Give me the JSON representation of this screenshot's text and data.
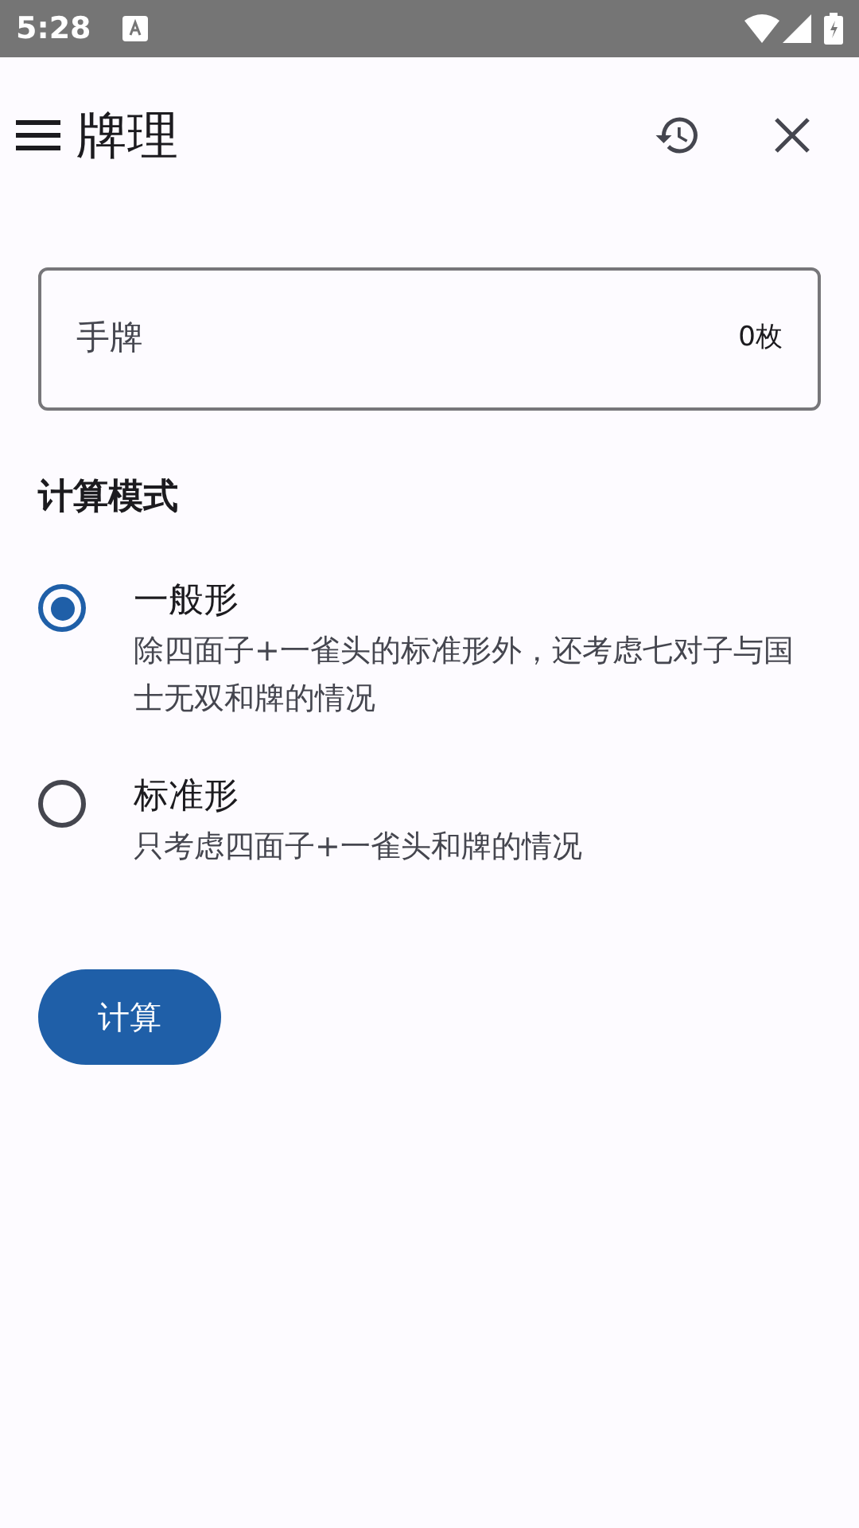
{
  "status_bar": {
    "time": "5:28"
  },
  "app_bar": {
    "title": "牌理"
  },
  "hand_field": {
    "placeholder": "手牌",
    "suffix": "0枚"
  },
  "mode_section": {
    "heading": "计算模式",
    "options": [
      {
        "label": "一般形",
        "description": "除四面子+一雀头的标准形外，还考虑七对子与国士无双和牌的情况",
        "selected": true
      },
      {
        "label": "标准形",
        "description": "只考虑四面子+一雀头和牌的情况",
        "selected": false
      }
    ]
  },
  "calculate_button": {
    "label": "计算"
  }
}
